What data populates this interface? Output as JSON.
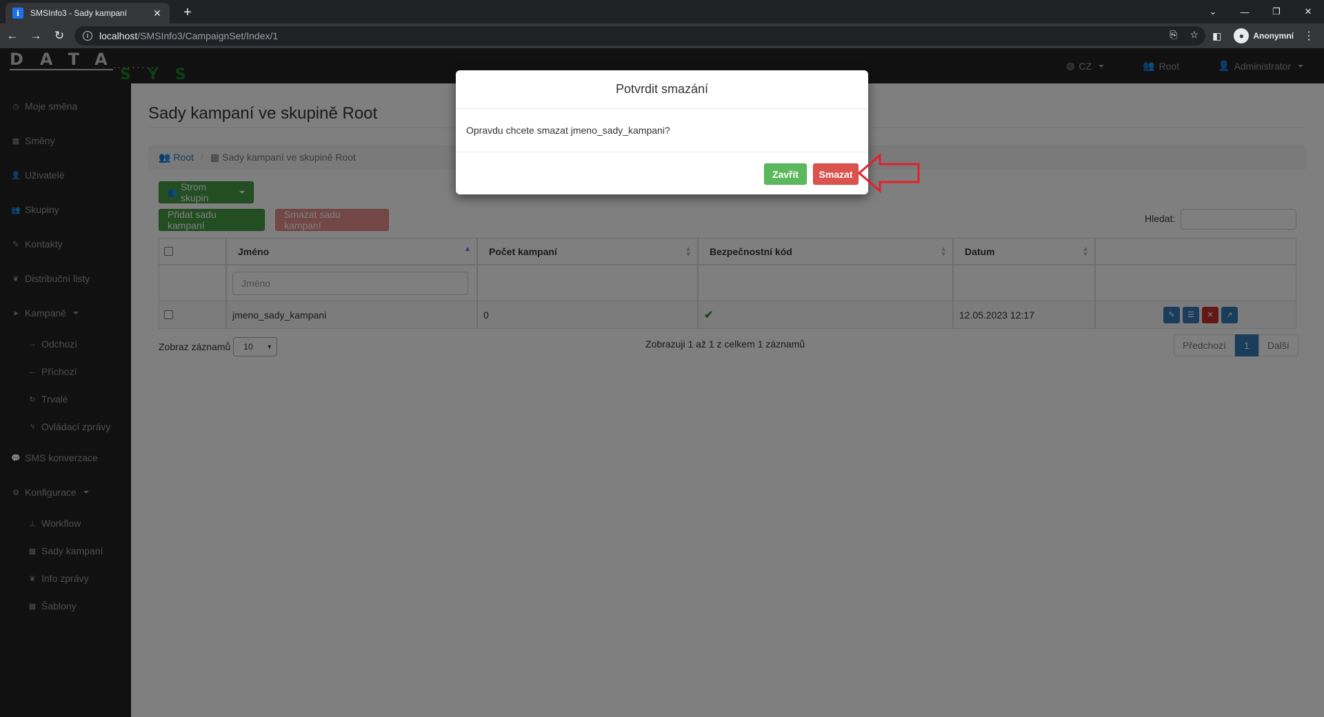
{
  "browser": {
    "tab_title": "SMSInfo3 - Sady kampaní",
    "url_host": "localhost",
    "url_path": "/SMSInfo3/CampaignSet/Index/1",
    "profile_label": "Anonymní"
  },
  "navbar": {
    "logo_top": "DATA",
    "logo_dots": "..........",
    "logo_bottom": "SYS",
    "lang": "CZ",
    "group": "Root",
    "user": "Administrator"
  },
  "sidebar": {
    "items": [
      {
        "label": "Moje směna",
        "icon": "clock-icon"
      },
      {
        "label": "Směny",
        "icon": "calendar-icon"
      },
      {
        "label": "Uživatelé",
        "icon": "user-icon"
      },
      {
        "label": "Skupiny",
        "icon": "users-icon"
      },
      {
        "label": "Kontakty",
        "icon": "edit-icon"
      },
      {
        "label": "Distribuční listy",
        "icon": "leaf-icon"
      },
      {
        "label": "Kampaně",
        "icon": "send-icon"
      },
      {
        "label": "Odchozí",
        "icon": "arrow-right-icon"
      },
      {
        "label": "Příchozí",
        "icon": "arrow-left-icon"
      },
      {
        "label": "Trvalé",
        "icon": "refresh-icon"
      },
      {
        "label": "Ovládací zprávy",
        "icon": "bolt-icon"
      },
      {
        "label": "SMS konverzace",
        "icon": "comments-icon"
      },
      {
        "label": "Konfigurace",
        "icon": "gear-icon"
      },
      {
        "label": "Workflow",
        "icon": "sitemap-icon"
      },
      {
        "label": "Sady kampaní",
        "icon": "table-icon"
      },
      {
        "label": "Info zprávy",
        "icon": "leaf-icon"
      },
      {
        "label": "Šablony",
        "icon": "table-icon"
      }
    ]
  },
  "main": {
    "title": "Sady kampaní ve skupině Root",
    "breadcrumb": {
      "root": "Root",
      "current": "Sady kampaní ve skupině Root"
    },
    "btn_tree": "Strom skupin",
    "btn_add": "Přidat sadu kampaní",
    "btn_delete": "Smazat sadu kampaní",
    "search_label": "Hledat:",
    "columns": {
      "name": "Jméno",
      "count": "Počet kampaní",
      "code": "Bezpečnostní kód",
      "date": "Datum"
    },
    "filter_placeholder": "Jméno",
    "row": {
      "name": "jmeno_sady_kampani",
      "count": "0",
      "date": "12.05.2023 12:17"
    },
    "page_size_label": "Zobraz záznamů",
    "page_size": "10",
    "info": "Zobrazuji 1 až 1 z celkem 1 záznamů",
    "pager": {
      "prev": "Předchozí",
      "current": "1",
      "next": "Další"
    }
  },
  "modal": {
    "title": "Potvrdit smazání",
    "body": "Opravdu chcete smazat jmeno_sady_kampani?",
    "btn_close": "Zavřít",
    "btn_delete": "Smazat"
  },
  "colors": {
    "green": "#5cb85c",
    "red": "#d9534f",
    "blue": "#337ab7",
    "annotation": "#e3202b"
  }
}
